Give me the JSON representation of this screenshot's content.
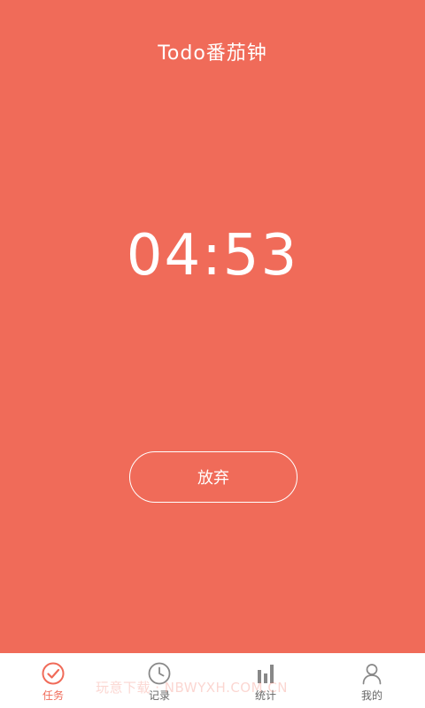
{
  "header": {
    "title": "Todo番茄钟"
  },
  "timer": {
    "display": "04:53"
  },
  "actions": {
    "give_up_label": "放弃"
  },
  "tabbar": {
    "items": [
      {
        "label": "任务",
        "icon": "check-circle-icon",
        "active": true
      },
      {
        "label": "记录",
        "icon": "clock-icon",
        "active": false
      },
      {
        "label": "统计",
        "icon": "bar-chart-icon",
        "active": false
      },
      {
        "label": "我的",
        "icon": "user-icon",
        "active": false
      }
    ]
  },
  "watermark": {
    "text": "玩意下载 · NBWYXH.COM.CN"
  },
  "colors": {
    "background": "#f06b59",
    "active_tab": "#f06b59",
    "inactive_icon": "#888888"
  }
}
